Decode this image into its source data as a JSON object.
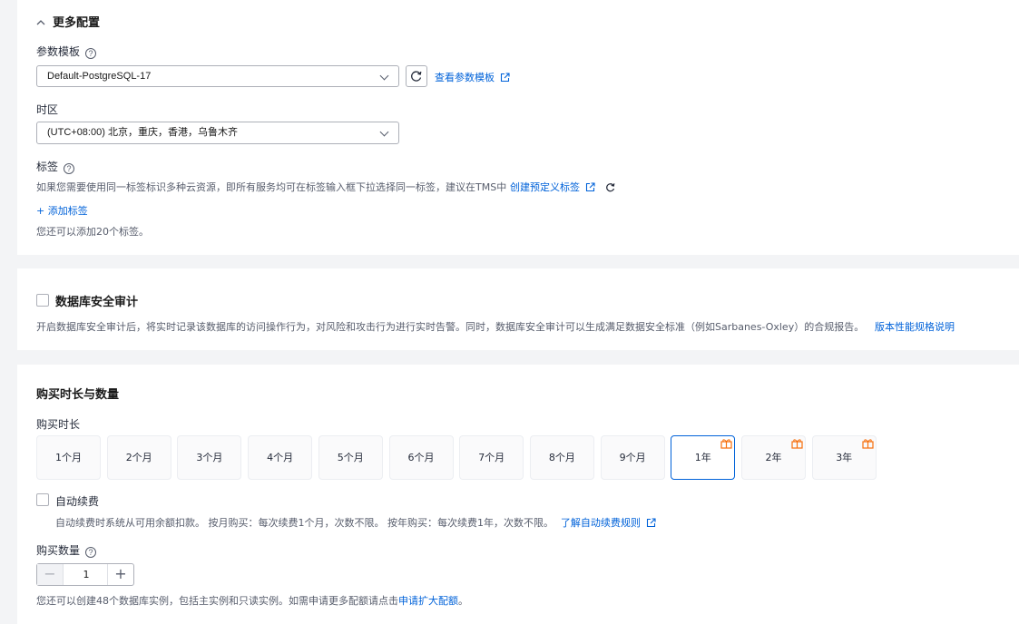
{
  "more_config": {
    "title": "更多配置",
    "param_template": {
      "label": "参数模板",
      "value": "Default-PostgreSQL-17",
      "view_link": "查看参数模板"
    },
    "timezone": {
      "label": "时区",
      "value": "(UTC+08:00) 北京，重庆，香港，乌鲁木齐"
    },
    "tags": {
      "label": "标签",
      "description": "如果您需要使用同一标签标识多种云资源，即所有服务均可在标签输入框下拉选择同一标签，建议在TMS中",
      "create_link": "创建预定义标签",
      "add_label": "+ 添加标签",
      "remaining": "您还可以添加20个标签。"
    }
  },
  "audit": {
    "title": "数据库安全审计",
    "description": "开启数据库安全审计后，将实时记录该数据库的访问操作行为，对风险和攻击行为进行实时告警。同时，数据库安全审计可以生成满足数据安全标准（例如Sarbanes-Oxley）的合规报告。",
    "spec_link": "版本性能规格说明"
  },
  "purchase": {
    "title": "购买时长与数量",
    "duration_label": "购买时长",
    "durations": [
      "1个月",
      "2个月",
      "3个月",
      "4个月",
      "5个月",
      "6个月",
      "7个月",
      "8个月",
      "9个月",
      "1年",
      "2年",
      "3年"
    ],
    "selected_duration": "1年",
    "auto_renew": {
      "label": "自动续费",
      "description": "自动续费时系统从可用余额扣款。 按月购买：每次续费1个月，次数不限。 按年购买：每次续费1年，次数不限。",
      "link": "了解自动续费规则"
    },
    "quantity": {
      "label": "购买数量",
      "value": "1",
      "note_prefix": "您还可以创建48个数据库实例，包括主实例和只读实例。如需申请更多配额请点击",
      "note_link": "申请扩大配额",
      "note_suffix": "。"
    }
  },
  "colors": {
    "link": "#0062d9",
    "selected_border": "#0062d9",
    "gift": "#f66f0c"
  }
}
